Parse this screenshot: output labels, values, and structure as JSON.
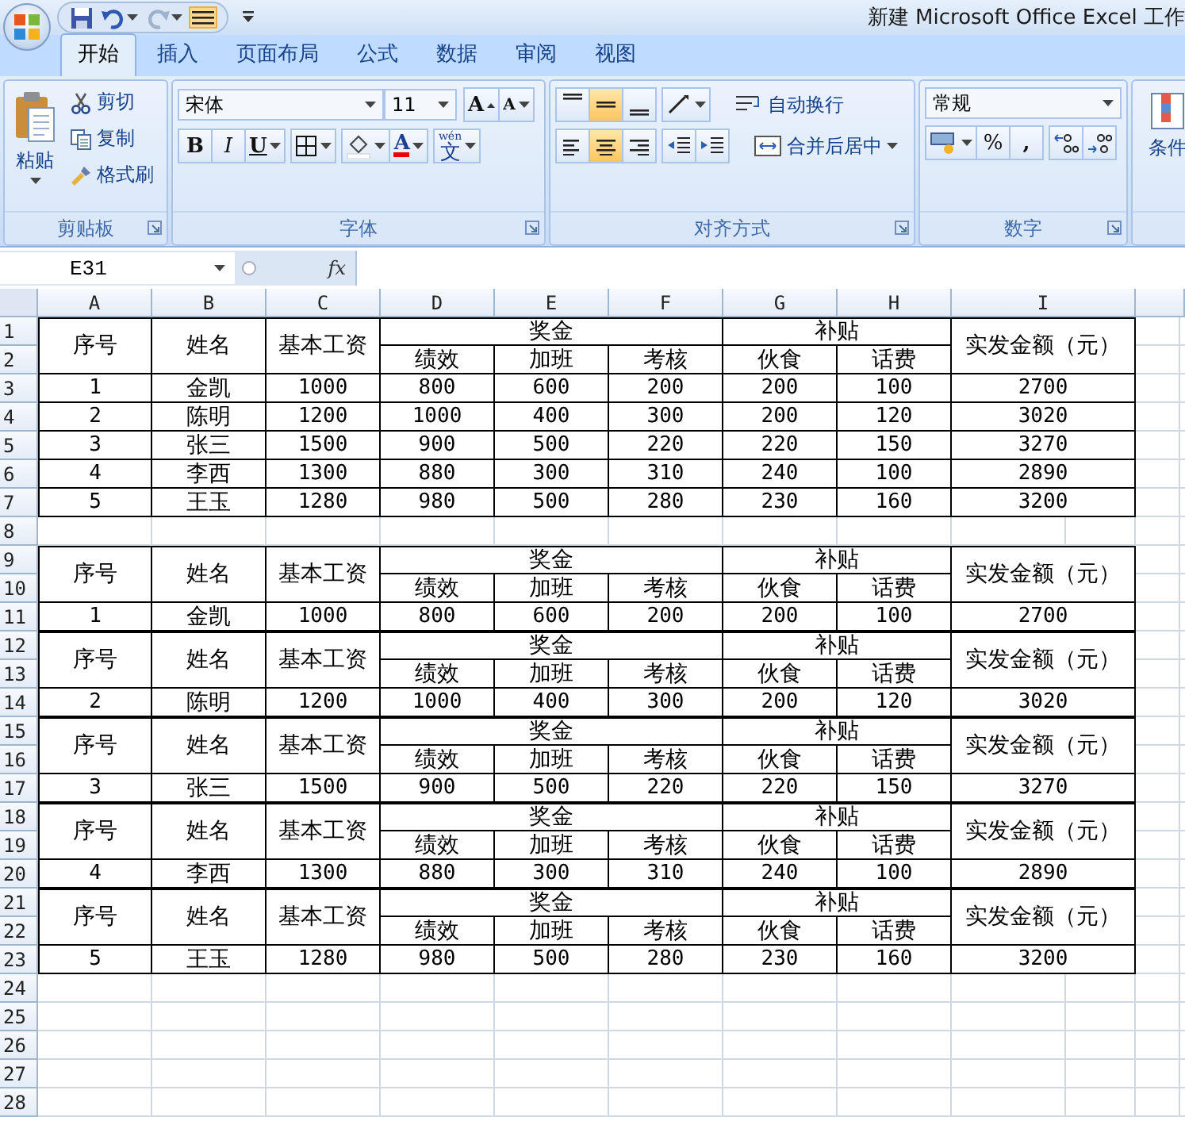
{
  "window": {
    "title": "新建 Microsoft Office Excel 工作"
  },
  "tabs": [
    {
      "label": "开始",
      "selected": true
    },
    {
      "label": "插入",
      "selected": false
    },
    {
      "label": "页面布局",
      "selected": false
    },
    {
      "label": "公式",
      "selected": false
    },
    {
      "label": "数据",
      "selected": false
    },
    {
      "label": "审阅",
      "selected": false
    },
    {
      "label": "视图",
      "selected": false
    }
  ],
  "ribbon": {
    "clipboard": {
      "paste": "粘贴",
      "cut": "剪切",
      "copy": "复制",
      "format_painter": "格式刷",
      "label": "剪贴板"
    },
    "font": {
      "name": "宋体",
      "size": "11",
      "grow": "A",
      "shrink": "A",
      "bold": "B",
      "italic": "I",
      "underline": "U",
      "font_color": "A",
      "phonetic_top": "wén",
      "phonetic_bottom": "文",
      "label": "字体"
    },
    "alignment": {
      "vertical": [
        {
          "kind": "top",
          "selected": false
        },
        {
          "kind": "middle",
          "selected": true
        },
        {
          "kind": "bottom",
          "selected": false
        }
      ],
      "horizontal": [
        {
          "kind": "left",
          "selected": false
        },
        {
          "kind": "center",
          "selected": true
        },
        {
          "kind": "right",
          "selected": false
        }
      ],
      "wrap_text": "自动换行",
      "merge_center": "合并后居中",
      "label": "对齐方式"
    },
    "number": {
      "format": "常规",
      "percent": "%",
      "comma": ",",
      "label": "数字"
    },
    "styles": {
      "conditional_format": "条件"
    }
  },
  "formula_bar": {
    "name_box": "E31",
    "fx": "fx"
  },
  "sheet": {
    "columns": [
      "A",
      "B",
      "C",
      "D",
      "E",
      "F",
      "G",
      "H",
      "I"
    ],
    "rows": [
      "1",
      "2",
      "3",
      "4",
      "5",
      "6",
      "7",
      "8",
      "9",
      "10",
      "11",
      "12",
      "13",
      "14",
      "15",
      "16",
      "17",
      "18",
      "19",
      "20",
      "21",
      "22",
      "23",
      "24",
      "25",
      "26",
      "27",
      "28"
    ],
    "tables": [
      {
        "header": {
          "number": "序号",
          "name": "姓名",
          "base": "基本工资",
          "bonus": "奖金",
          "bonus_items": [
            "绩效",
            "加班",
            "考核"
          ],
          "allowance": "补贴",
          "allowance_items": [
            "伙食",
            "话费"
          ],
          "total": "实发金额（元）"
        },
        "rows": [
          [
            "1",
            "金凯",
            "1000",
            "800",
            "600",
            "200",
            "200",
            "100",
            "2700"
          ],
          [
            "2",
            "陈明",
            "1200",
            "1000",
            "400",
            "300",
            "200",
            "120",
            "3020"
          ],
          [
            "3",
            "张三",
            "1500",
            "900",
            "500",
            "220",
            "220",
            "150",
            "3270"
          ],
          [
            "4",
            "李西",
            "1300",
            "880",
            "300",
            "310",
            "240",
            "100",
            "2890"
          ],
          [
            "5",
            "王玉",
            "1280",
            "980",
            "500",
            "280",
            "230",
            "160",
            "3200"
          ]
        ]
      },
      {
        "header": {
          "number": "序号",
          "name": "姓名",
          "base": "基本工资",
          "bonus": "奖金",
          "bonus_items": [
            "绩效",
            "加班",
            "考核"
          ],
          "allowance": "补贴",
          "allowance_items": [
            "伙食",
            "话费"
          ],
          "total": "实发金额（元）"
        },
        "rows": [
          [
            "1",
            "金凯",
            "1000",
            "800",
            "600",
            "200",
            "200",
            "100",
            "2700"
          ]
        ]
      },
      {
        "header": {
          "number": "序号",
          "name": "姓名",
          "base": "基本工资",
          "bonus": "奖金",
          "bonus_items": [
            "绩效",
            "加班",
            "考核"
          ],
          "allowance": "补贴",
          "allowance_items": [
            "伙食",
            "话费"
          ],
          "total": "实发金额（元）"
        },
        "rows": [
          [
            "2",
            "陈明",
            "1200",
            "1000",
            "400",
            "300",
            "200",
            "120",
            "3020"
          ]
        ]
      },
      {
        "header": {
          "number": "序号",
          "name": "姓名",
          "base": "基本工资",
          "bonus": "奖金",
          "bonus_items": [
            "绩效",
            "加班",
            "考核"
          ],
          "allowance": "补贴",
          "allowance_items": [
            "伙食",
            "话费"
          ],
          "total": "实发金额（元）"
        },
        "rows": [
          [
            "3",
            "张三",
            "1500",
            "900",
            "500",
            "220",
            "220",
            "150",
            "3270"
          ]
        ]
      },
      {
        "header": {
          "number": "序号",
          "name": "姓名",
          "base": "基本工资",
          "bonus": "奖金",
          "bonus_items": [
            "绩效",
            "加班",
            "考核"
          ],
          "allowance": "补贴",
          "allowance_items": [
            "伙食",
            "话费"
          ],
          "total": "实发金额（元）"
        },
        "rows": [
          [
            "4",
            "李西",
            "1300",
            "880",
            "300",
            "310",
            "240",
            "100",
            "2890"
          ]
        ]
      },
      {
        "header": {
          "number": "序号",
          "name": "姓名",
          "base": "基本工资",
          "bonus": "奖金",
          "bonus_items": [
            "绩效",
            "加班",
            "考核"
          ],
          "allowance": "补贴",
          "allowance_items": [
            "伙食",
            "话费"
          ],
          "total": "实发金额（元）"
        },
        "rows": [
          [
            "5",
            "王玉",
            "1280",
            "980",
            "500",
            "280",
            "230",
            "160",
            "3200"
          ]
        ]
      }
    ]
  }
}
